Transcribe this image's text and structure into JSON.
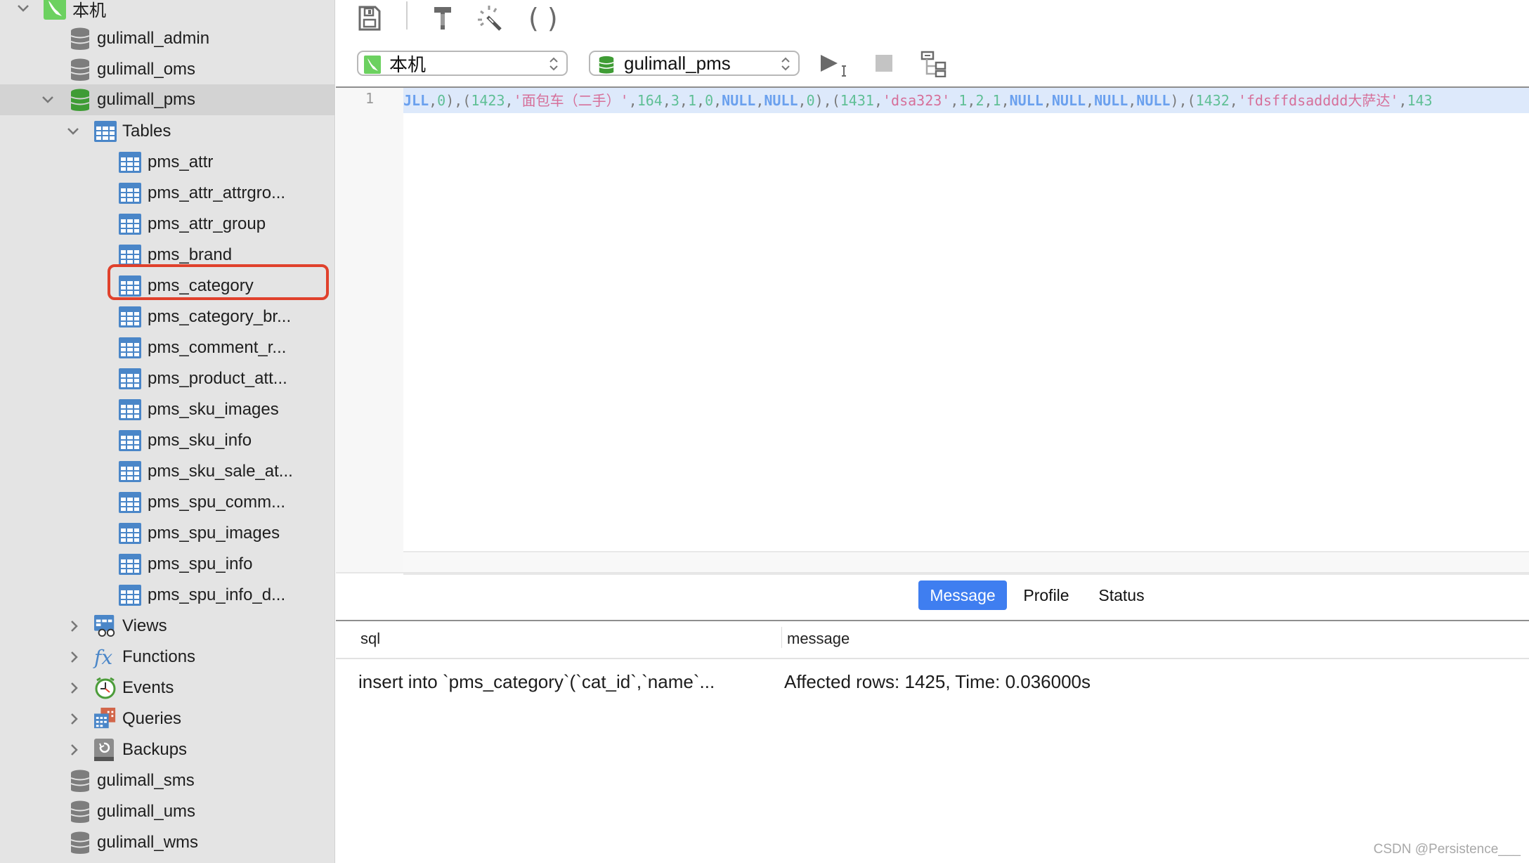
{
  "sidebar": {
    "connection": {
      "label": "本机",
      "icon": "mysql-dolphin-icon",
      "expanded": true
    },
    "databases_before": [
      {
        "label": "gulimall_admin",
        "icon": "database-icon"
      },
      {
        "label": "gulimall_oms",
        "icon": "database-icon"
      }
    ],
    "active_database": {
      "label": "gulimall_pms",
      "icon": "database-active-icon",
      "expanded": true
    },
    "tables_group": {
      "label": "Tables",
      "expanded": true
    },
    "tables": [
      "pms_attr",
      "pms_attr_attrgro...",
      "pms_attr_group",
      "pms_brand",
      "pms_category",
      "pms_category_br...",
      "pms_comment_r...",
      "pms_product_att...",
      "pms_sku_images",
      "pms_sku_info",
      "pms_sku_sale_at...",
      "pms_spu_comm...",
      "pms_spu_images",
      "pms_spu_info",
      "pms_spu_info_d..."
    ],
    "highlighted_table": "pms_category",
    "groups": [
      {
        "label": "Views",
        "icon": "views-icon"
      },
      {
        "label": "Functions",
        "icon": "functions-icon"
      },
      {
        "label": "Events",
        "icon": "events-clock-icon"
      },
      {
        "label": "Queries",
        "icon": "queries-icon"
      },
      {
        "label": "Backups",
        "icon": "backups-icon"
      }
    ],
    "databases_after": [
      {
        "label": "gulimall_sms",
        "icon": "database-icon"
      },
      {
        "label": "gulimall_ums",
        "icon": "database-icon"
      },
      {
        "label": "gulimall_wms",
        "icon": "database-icon"
      }
    ]
  },
  "toolbar": {
    "icons": [
      "save-icon",
      "build-hammer-icon",
      "magic-wand-icon",
      "parentheses-icon"
    ],
    "connection_select": "本机",
    "database_select": "gulimall_pms",
    "run_icon": "run-icon",
    "stop_icon": "stop-icon",
    "explain_icon": "explain-tree-icon"
  },
  "editor": {
    "line_number": "1",
    "tokens": [
      {
        "t": "kw",
        "v": "JLL"
      },
      {
        "t": "p",
        "v": ","
      },
      {
        "t": "num",
        "v": "0"
      },
      {
        "t": "p",
        "v": "),("
      },
      {
        "t": "num",
        "v": "1423"
      },
      {
        "t": "p",
        "v": ","
      },
      {
        "t": "str",
        "v": "'面包车（二手）'"
      },
      {
        "t": "p",
        "v": ","
      },
      {
        "t": "num",
        "v": "164"
      },
      {
        "t": "p",
        "v": ","
      },
      {
        "t": "num",
        "v": "3"
      },
      {
        "t": "p",
        "v": ","
      },
      {
        "t": "num",
        "v": "1"
      },
      {
        "t": "p",
        "v": ","
      },
      {
        "t": "num",
        "v": "0"
      },
      {
        "t": "p",
        "v": ","
      },
      {
        "t": "kw",
        "v": "NULL"
      },
      {
        "t": "p",
        "v": ","
      },
      {
        "t": "kw",
        "v": "NULL"
      },
      {
        "t": "p",
        "v": ","
      },
      {
        "t": "num",
        "v": "0"
      },
      {
        "t": "p",
        "v": "),("
      },
      {
        "t": "num",
        "v": "1431"
      },
      {
        "t": "p",
        "v": ","
      },
      {
        "t": "str",
        "v": "'dsa323'"
      },
      {
        "t": "p",
        "v": ","
      },
      {
        "t": "num",
        "v": "1"
      },
      {
        "t": "p",
        "v": ","
      },
      {
        "t": "num",
        "v": "2"
      },
      {
        "t": "p",
        "v": ","
      },
      {
        "t": "num",
        "v": "1"
      },
      {
        "t": "p",
        "v": ","
      },
      {
        "t": "kw",
        "v": "NULL"
      },
      {
        "t": "p",
        "v": ","
      },
      {
        "t": "kw",
        "v": "NULL"
      },
      {
        "t": "p",
        "v": ","
      },
      {
        "t": "kw",
        "v": "NULL"
      },
      {
        "t": "p",
        "v": ","
      },
      {
        "t": "kw",
        "v": "NULL"
      },
      {
        "t": "p",
        "v": "),("
      },
      {
        "t": "num",
        "v": "1432"
      },
      {
        "t": "p",
        "v": ","
      },
      {
        "t": "str",
        "v": "'fdsffdsadddd大萨达'"
      },
      {
        "t": "p",
        "v": ","
      },
      {
        "t": "num",
        "v": "143"
      }
    ]
  },
  "results": {
    "tabs": [
      {
        "label": "Message",
        "active": true
      },
      {
        "label": "Profile",
        "active": false
      },
      {
        "label": "Status",
        "active": false
      }
    ],
    "columns": [
      "sql",
      "message"
    ],
    "rows": [
      {
        "sql": "insert  into `pms_category`(`cat_id`,`name`...",
        "message": "Affected rows: 1425, Time: 0.036000s"
      }
    ]
  },
  "watermark": "CSDN @Persistence___",
  "colors": {
    "accent": "#3f7ef0",
    "highlight_box": "#e0412c",
    "db_active": "#3f9c35",
    "table_icon": "#4a86c8"
  }
}
